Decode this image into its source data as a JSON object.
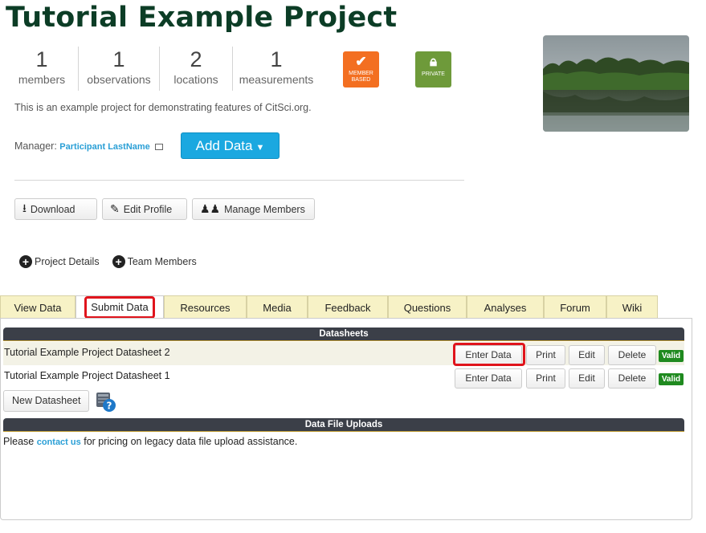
{
  "project": {
    "title": "Tutorial Example Project",
    "description": "This is an example project for demonstrating features of CitSci.org."
  },
  "stats": [
    {
      "value": "1",
      "label": "members"
    },
    {
      "value": "1",
      "label": "observations"
    },
    {
      "value": "2",
      "label": "locations"
    },
    {
      "value": "1",
      "label": "measurements"
    }
  ],
  "badges": {
    "member": {
      "line1": "MEMBER",
      "line2": "BASED",
      "color": "#f36f21"
    },
    "private": {
      "label": "PRIVATE",
      "color": "#6e9a3a"
    }
  },
  "manager": {
    "label": "Manager:",
    "name": "Participant LastName"
  },
  "add_data_label": "Add Data",
  "actions": {
    "download": "Download",
    "edit_profile": "Edit Profile",
    "manage_members": "Manage Members"
  },
  "links": {
    "project_details": "Project Details",
    "team_members": "Team Members"
  },
  "tabs": [
    "View Data",
    "Submit Data",
    "Resources",
    "Media",
    "Feedback",
    "Questions",
    "Analyses",
    "Forum",
    "Wiki"
  ],
  "active_tab": "Submit Data",
  "datasheets": {
    "heading": "Datasheets",
    "rows": [
      {
        "name": "Tutorial Example Project Datasheet 2",
        "enter": "Enter Data",
        "print": "Print",
        "edit": "Edit",
        "delete": "Delete",
        "status": "Valid"
      },
      {
        "name": "Tutorial Example Project Datasheet 1",
        "enter": "Enter Data",
        "print": "Print",
        "edit": "Edit",
        "delete": "Delete",
        "status": "Valid"
      }
    ],
    "new_label": "New Datasheet"
  },
  "uploads": {
    "heading": "Data File Uploads",
    "prefix": "Please",
    "link": "contact us",
    "suffix": "for pricing on legacy data file upload assistance."
  }
}
